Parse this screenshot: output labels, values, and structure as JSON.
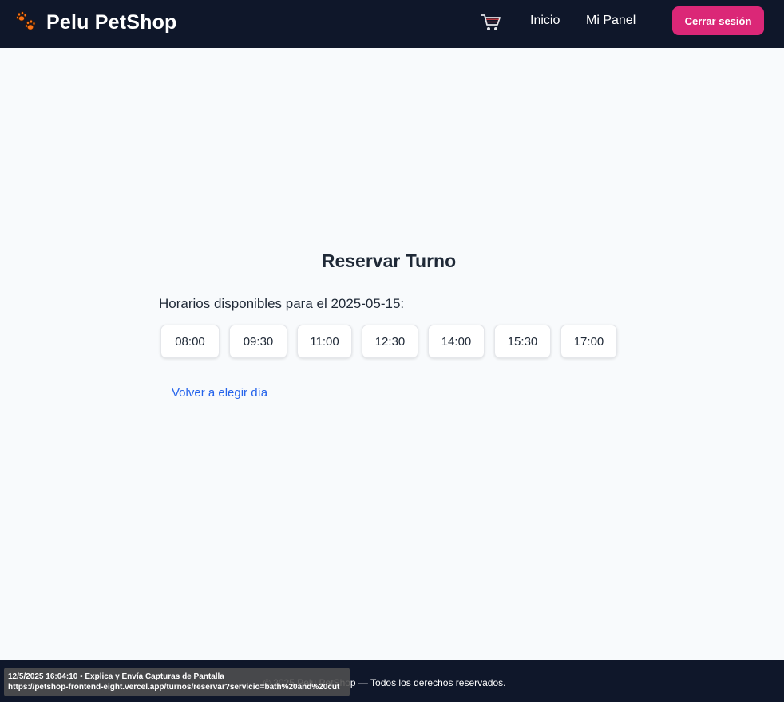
{
  "navbar": {
    "brand": "Pelu PetShop",
    "brand_icon": "paw-icon",
    "cart_icon": "cart-icon",
    "links": [
      "Inicio",
      "Mi Panel"
    ],
    "logout_label": "Cerrar sesión",
    "background_color": "#0f172a",
    "accent_color": "#db2777"
  },
  "main": {
    "title": "Reservar Turno",
    "slots_heading": "Horarios disponibles para el 2025-05-15:",
    "slots": [
      "08:00",
      "09:30",
      "11:00",
      "12:30",
      "14:00",
      "15:30",
      "17:00"
    ],
    "back_link": "Volver a elegir día",
    "link_color": "#2563eb"
  },
  "footer": {
    "text": "© 2025 Pelu PetShop — Todos los derechos reservados."
  },
  "overlay": {
    "line1": "12/5/2025 16:04:10 • Explica y Envía Capturas de Pantalla",
    "line2": "https://petshop-frontend-eight.vercel.app/turnos/reservar?servicio=bath%20and%20cut"
  }
}
